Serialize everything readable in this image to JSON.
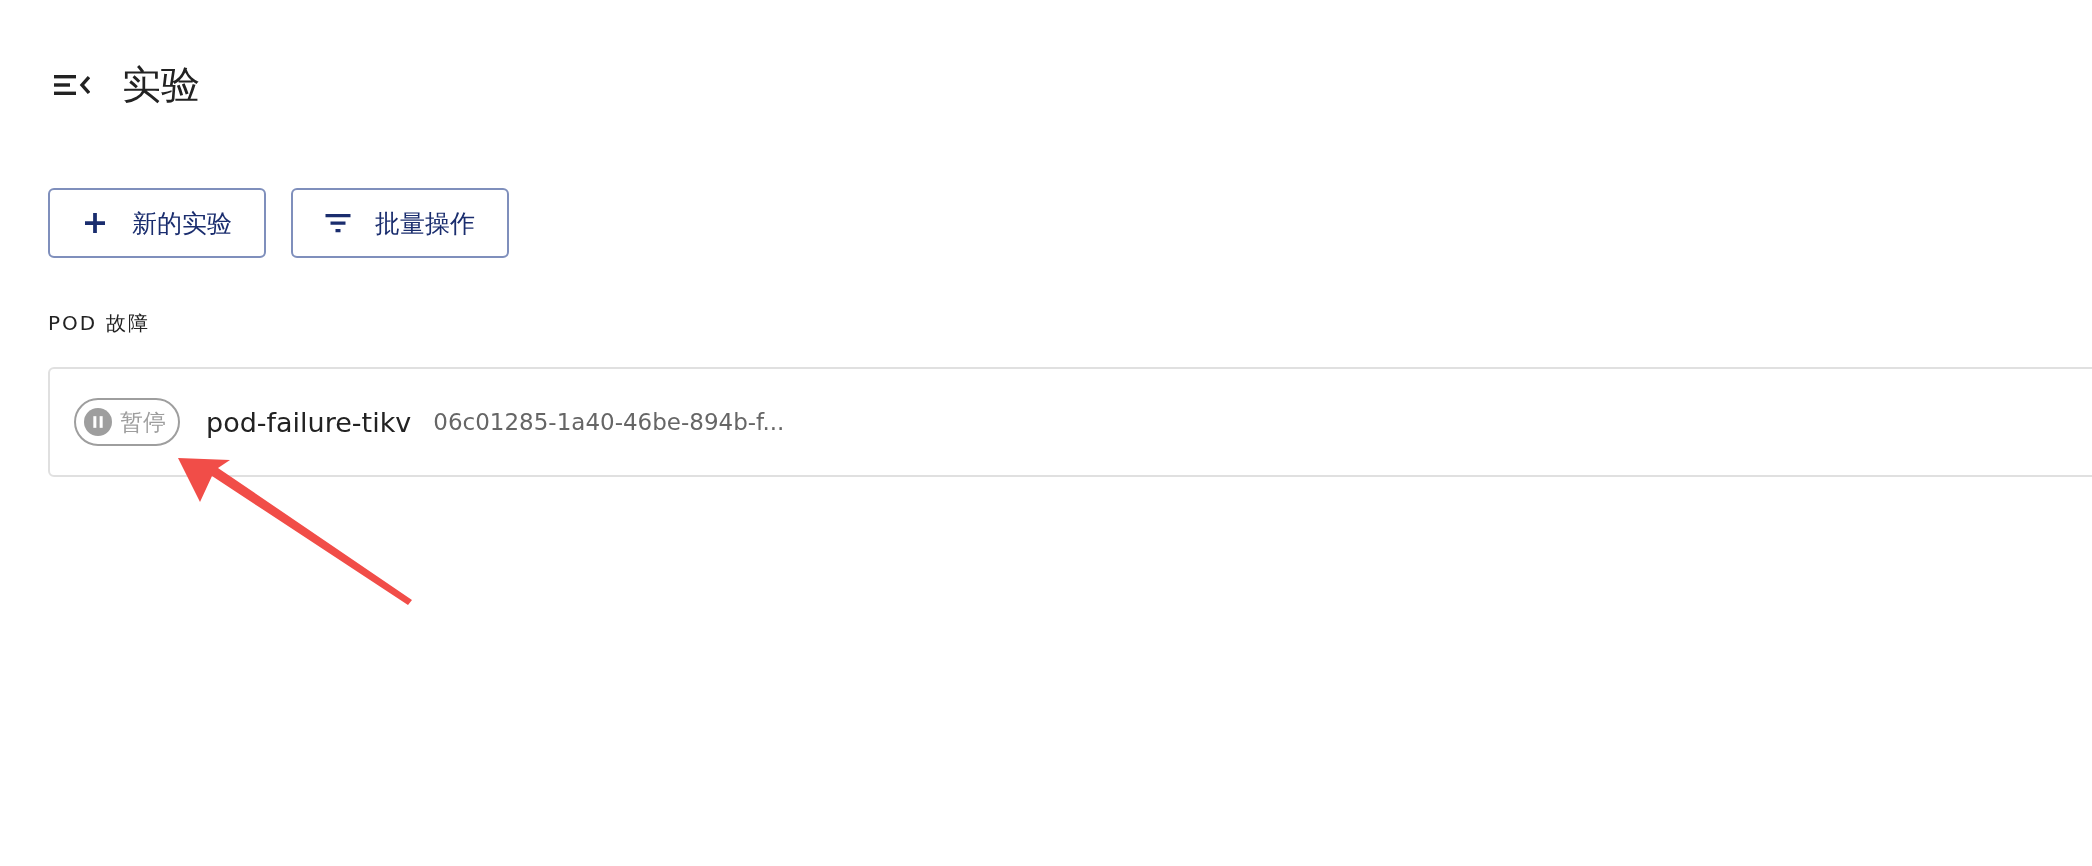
{
  "header": {
    "title": "实验"
  },
  "toolbar": {
    "buttons": [
      {
        "kind": "add",
        "label": "新的实验"
      },
      {
        "kind": "filter",
        "label": "批量操作"
      }
    ]
  },
  "sections": [
    {
      "title": "POD 故障",
      "experiments": [
        {
          "status": {
            "kind": "paused",
            "label": "暂停"
          },
          "name": "pod-failure-tikv",
          "uid": "06c01285-1a40-46be-894b-f..."
        }
      ]
    }
  ],
  "annotation": {
    "kind": "arrow"
  }
}
